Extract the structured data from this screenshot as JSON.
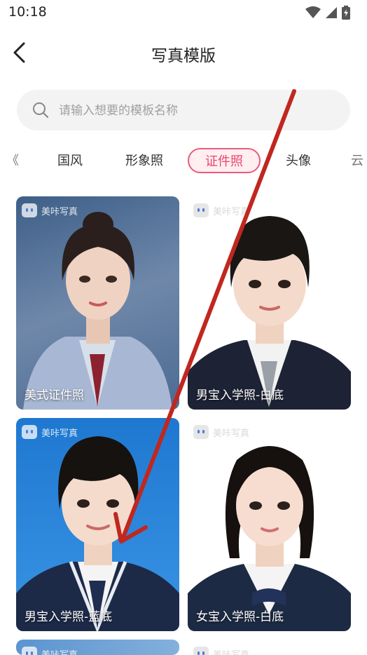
{
  "status": {
    "time": "10:18"
  },
  "nav": {
    "title": "写真模版"
  },
  "search": {
    "placeholder": "请输入想要的模板名称"
  },
  "tabs": [
    {
      "label": "《"
    },
    {
      "label": "国风"
    },
    {
      "label": "形象照"
    },
    {
      "label": "证件照",
      "active": true
    },
    {
      "label": "头像"
    },
    {
      "label": "云"
    }
  ],
  "cards": [
    {
      "caption": "美式证件照",
      "watermark": "美咔写真",
      "bg": "#4b6b93"
    },
    {
      "caption": "男宝入学照-白底",
      "watermark": "美咔写真",
      "bg": "#ffffff"
    },
    {
      "caption": "男宝入学照-蓝底",
      "watermark": "美咔写真",
      "bg": "#2f86d6"
    },
    {
      "caption": "女宝入学照-白底",
      "watermark": "美咔写真",
      "bg": "#ffffff"
    }
  ],
  "next_row": {
    "watermark": "美咔写真"
  },
  "colors": {
    "accent": "#e8456b",
    "annotation_arrow": "#c0271f"
  }
}
